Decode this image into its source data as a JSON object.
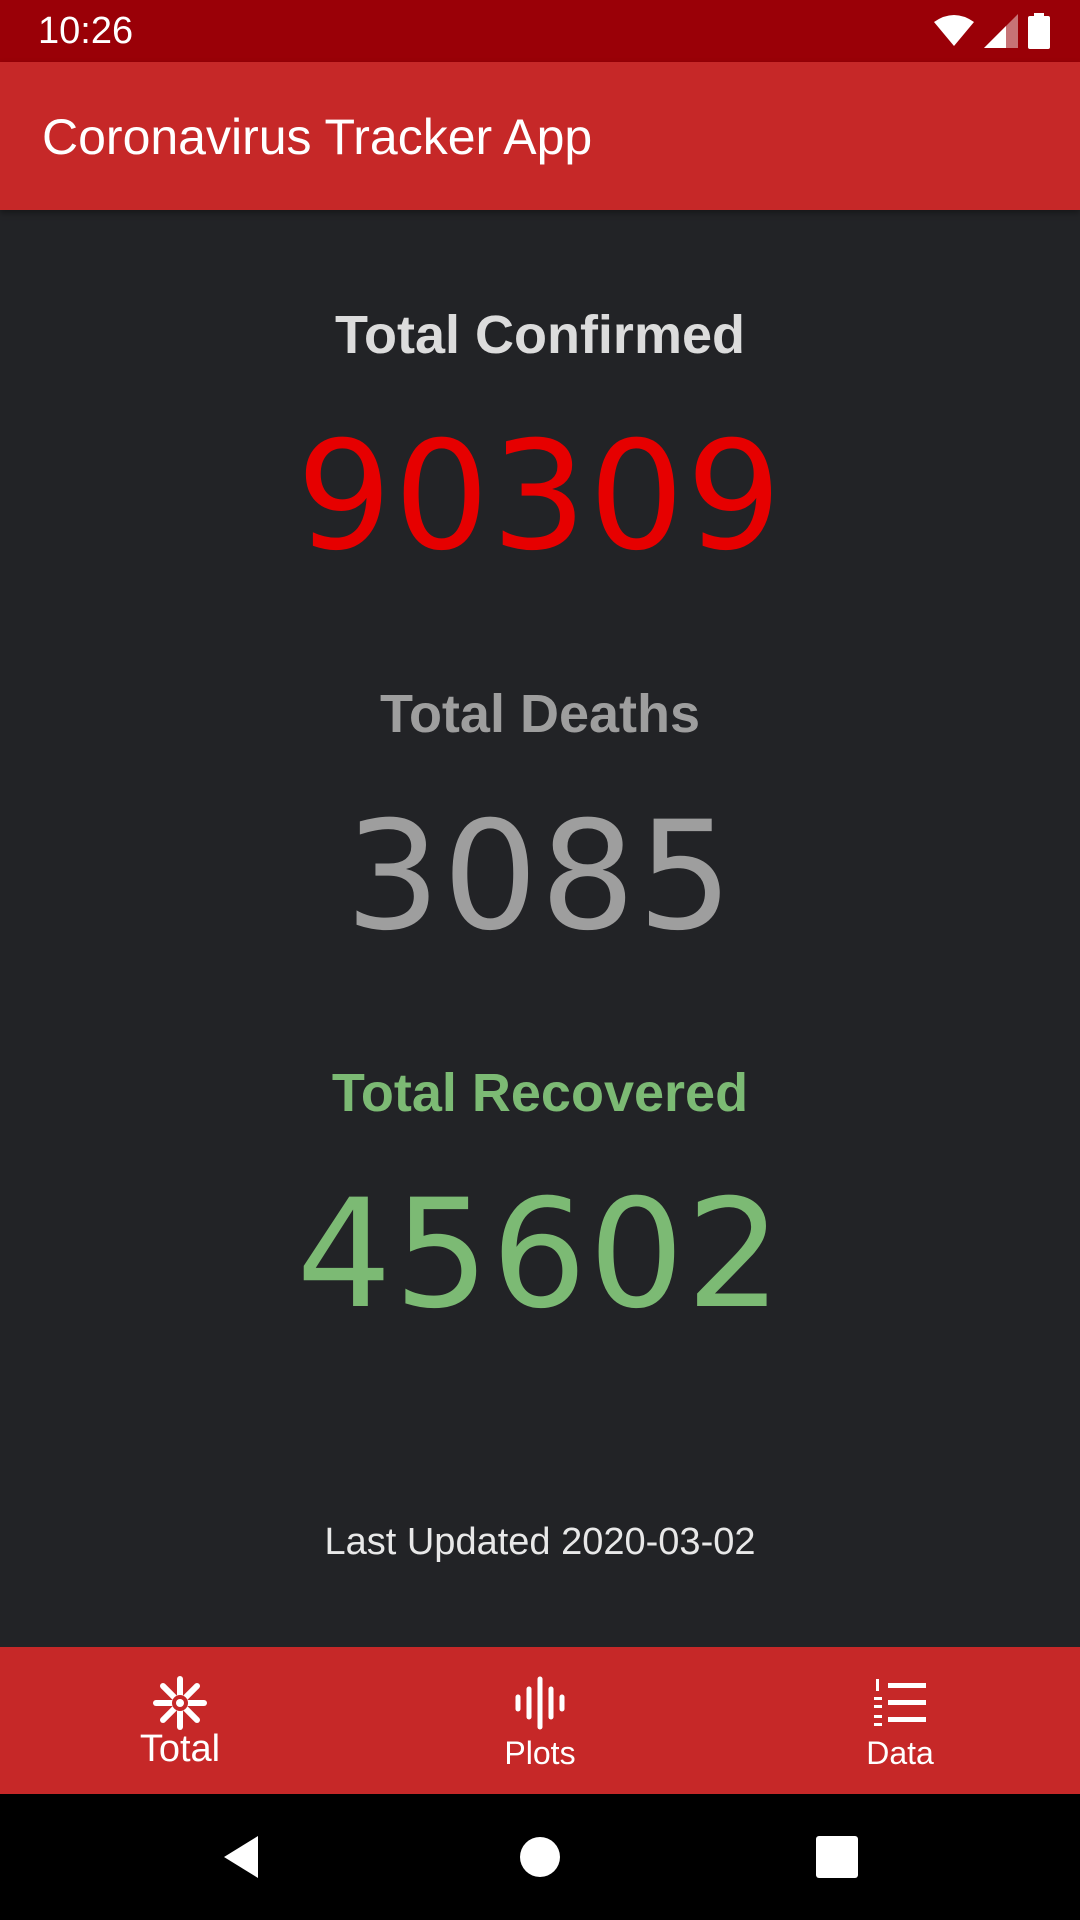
{
  "status_bar": {
    "time": "10:26",
    "icons": [
      "wifi-icon",
      "cell-signal-icon",
      "battery-icon"
    ]
  },
  "app_bar": {
    "title": "Coronavirus Tracker App"
  },
  "stats": {
    "confirmed": {
      "label": "Total Confirmed",
      "value": "90309",
      "color": "#e60000"
    },
    "deaths": {
      "label": "Total Deaths",
      "value": "3085",
      "color": "#9e9e9e"
    },
    "recovered": {
      "label": "Total Recovered",
      "value": "45602",
      "color": "#7cba74"
    }
  },
  "last_updated": {
    "label": "Last Updated",
    "date": "2020-03-02"
  },
  "bottom_nav": {
    "items": [
      {
        "label": "Total",
        "icon": "asterisk-icon",
        "active": true
      },
      {
        "label": "Plots",
        "icon": "waveform-icon",
        "active": false
      },
      {
        "label": "Data",
        "icon": "numbered-list-icon",
        "active": false
      }
    ]
  },
  "system_nav": {
    "buttons": [
      "back-icon",
      "home-icon",
      "recents-icon"
    ]
  },
  "colors": {
    "status_bar": "#9a0007",
    "app_bar": "#c62828",
    "background": "#222326"
  }
}
